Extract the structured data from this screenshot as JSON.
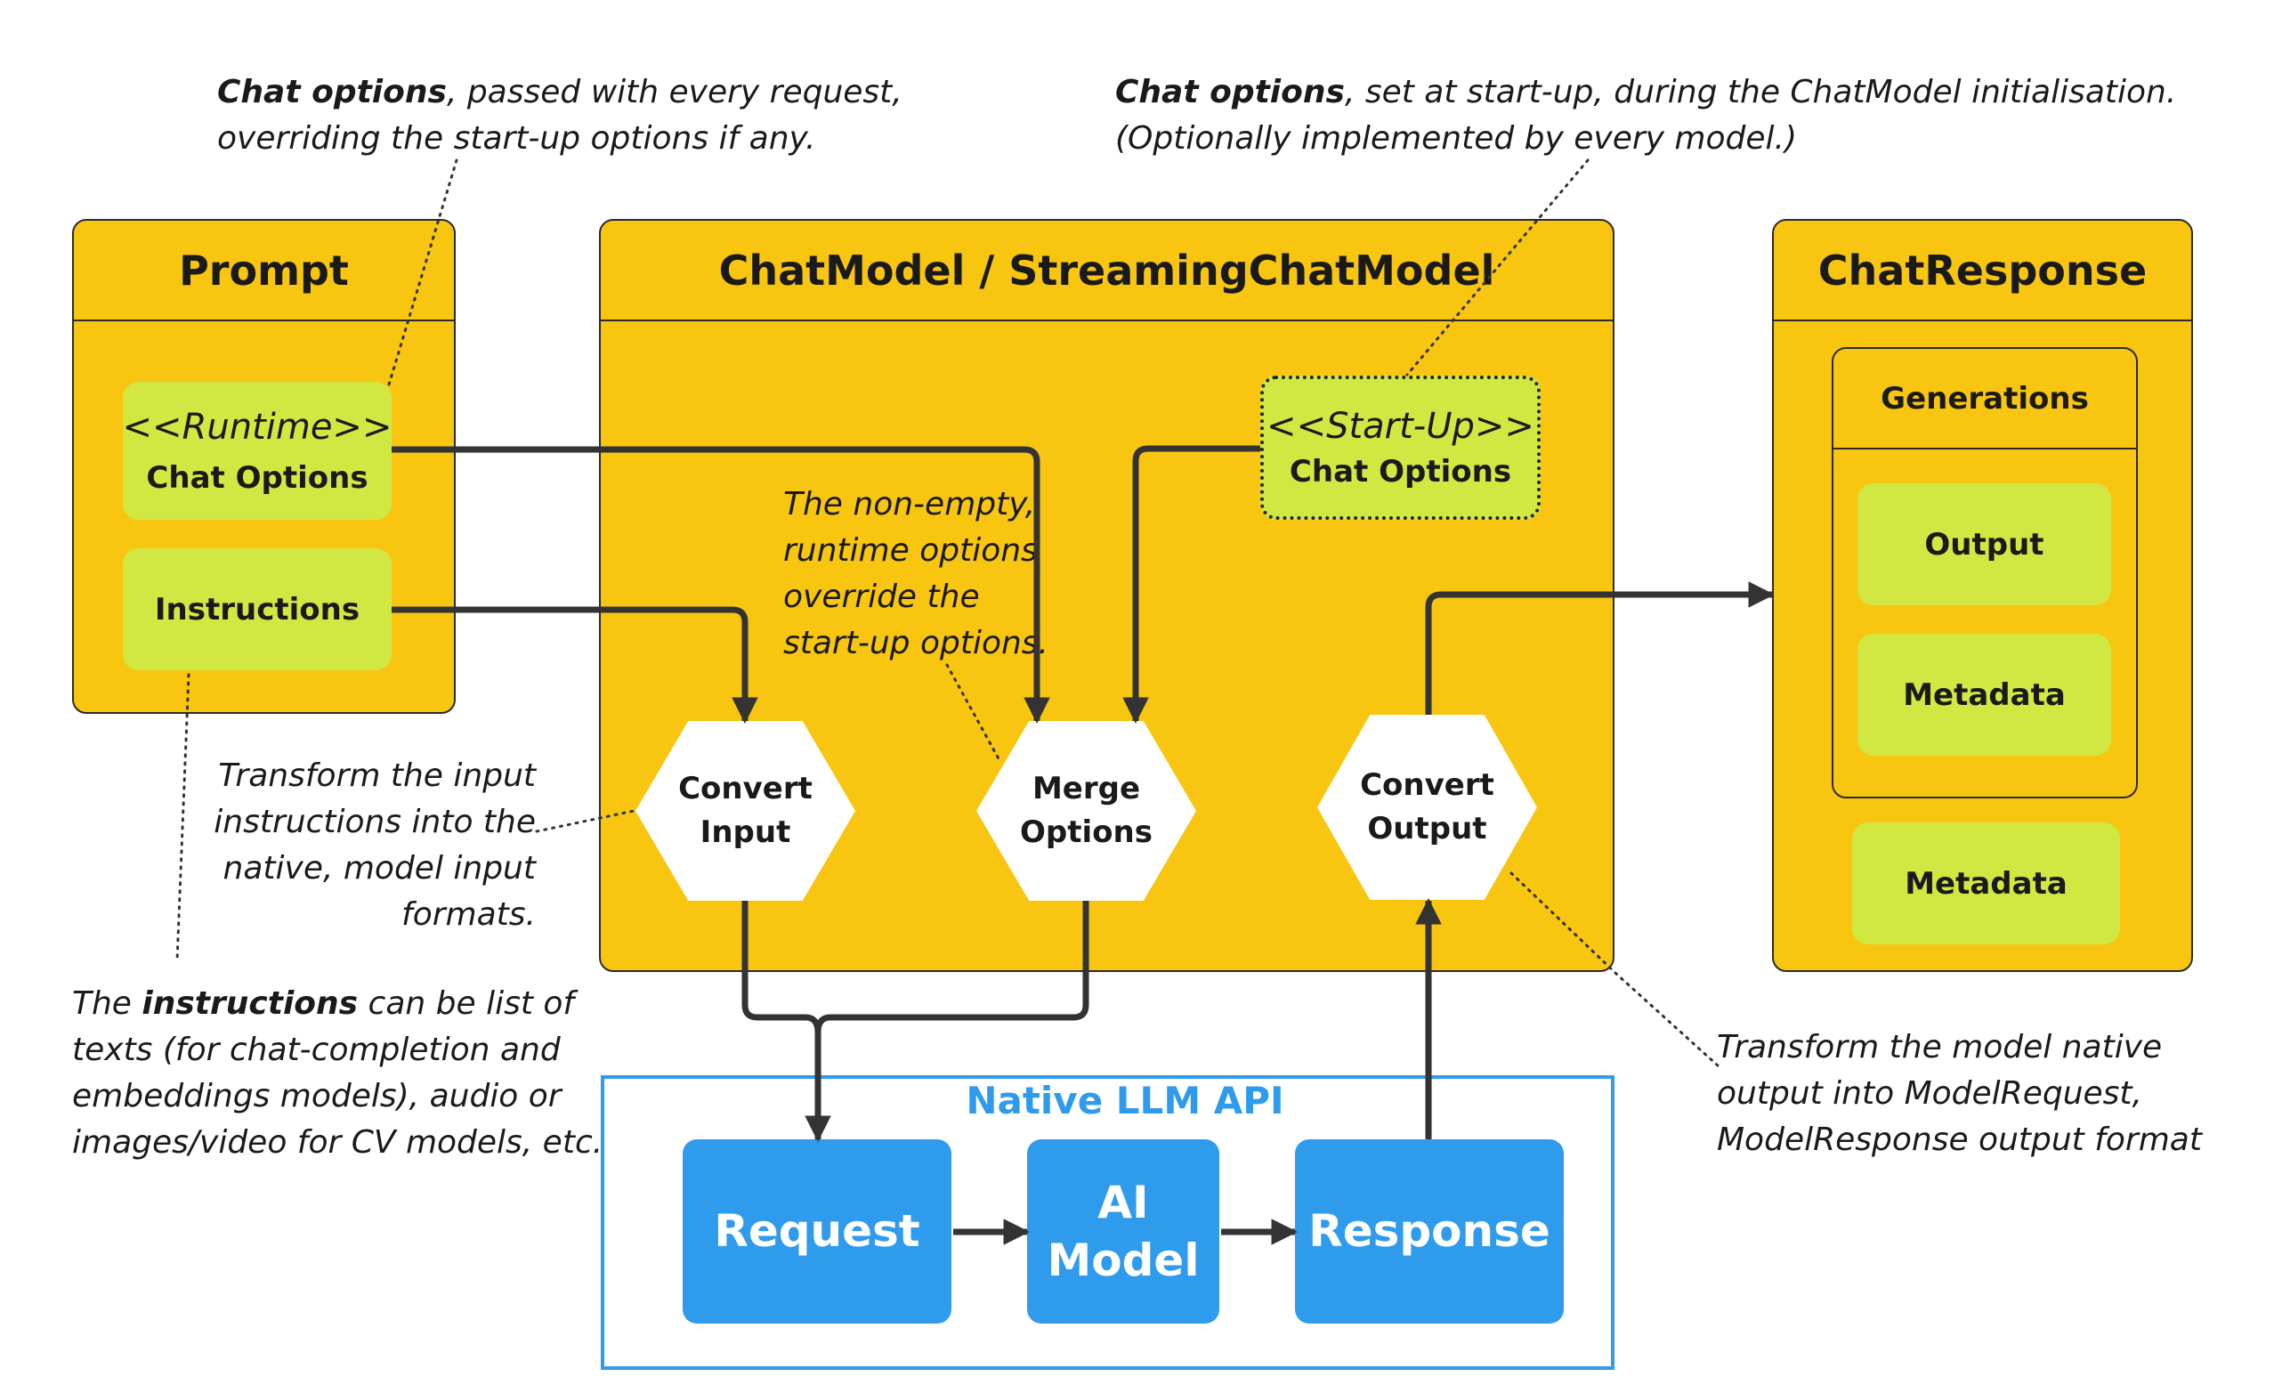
{
  "colors": {
    "container": "#F8C511",
    "item": "#D1E843",
    "api": "#2F9BEC",
    "line": "#333333"
  },
  "prompt": {
    "title": "Prompt",
    "runtime_options": {
      "stereotype": "<<Runtime>>",
      "label": "Chat Options"
    },
    "instructions": {
      "label": "Instructions"
    }
  },
  "chat_model": {
    "title": "ChatModel / StreamingChatModel",
    "startup_options": {
      "stereotype": "<<Start-Up>>",
      "label": "Chat Options"
    },
    "steps": {
      "convert_input": [
        "Convert",
        "Input"
      ],
      "merge_options": [
        "Merge",
        "Options"
      ],
      "convert_output": [
        "Convert",
        "Output"
      ]
    }
  },
  "chat_response": {
    "title": "ChatResponse",
    "generations": {
      "title": "Generations",
      "output": "Output",
      "metadata": "Metadata"
    },
    "metadata": "Metadata"
  },
  "native_api": {
    "title": "Native LLM API",
    "request": "Request",
    "ai_model": [
      "AI",
      "Model"
    ],
    "response": "Response"
  },
  "notes": {
    "runtime_options": {
      "bold": "Chat options",
      "line1_rest": ", passed with every  request,",
      "line2": "overriding the start-up options if any."
    },
    "startup_options": {
      "bold": "Chat options",
      "line1_rest": ", set at start-up, during  the ChatModel initialisation.",
      "line2": "(Optionally implemented by every model.)"
    },
    "merge": [
      "The non-empty,",
      "runtime options",
      "override the",
      "start-up options."
    ],
    "convert_input": [
      "Transform the input",
      "instructions into the",
      "native, model input",
      "formats."
    ],
    "instructions": {
      "pre": "The ",
      "bold": "instructions",
      "line1_rest": " can be list of",
      "lines": [
        "texts (for chat-completion and",
        "embeddings models), audio or",
        "images/video for CV models, etc."
      ]
    },
    "convert_output": [
      "Transform the model native",
      "output into ModelRequest,",
      "ModelResponse output format"
    ]
  }
}
